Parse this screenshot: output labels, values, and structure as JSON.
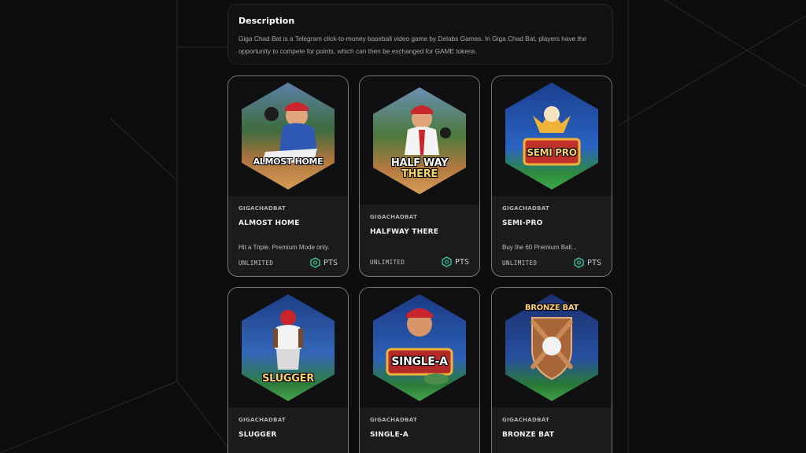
{
  "description": {
    "title": "Description",
    "text": "Giga Chad Bat is a Telegram click-to-money baseball video game by Delabs Games. In Giga Chad Bat, players have the opportunity to compete for points, which can then be exchanged for GAME tokens."
  },
  "cards": [
    {
      "org": "GIGACHADBAT",
      "title": "ALMOST HOME",
      "badge": "ALMOST HOME",
      "desc": "Hit a Triple. Premium Mode only.",
      "supply": "UNLIMITED",
      "price": "PTS",
      "icon": "player-sliding-icon"
    },
    {
      "org": "GIGACHADBAT",
      "title": "HALFWAY THERE",
      "badge_line1": "HALF WAY",
      "badge_line2": "THERE",
      "desc": "",
      "supply": "UNLIMITED",
      "price": "PTS",
      "icon": "player-running-icon"
    },
    {
      "org": "GIGACHADBAT",
      "title": "SEMI-PRO",
      "badge": "SEMI PRO",
      "desc": "Buy the 60 Premium Ball...",
      "supply": "UNLIMITED",
      "price": "PTS",
      "icon": "baseball-trophy-icon"
    },
    {
      "org": "GIGACHADBAT",
      "title": "SLUGGER",
      "badge": "SLUGGER",
      "icon": "batter-back-icon"
    },
    {
      "org": "GIGACHADBAT",
      "title": "SINGLE-A",
      "badge": "SINGLE-A",
      "icon": "player-portrait-icon"
    },
    {
      "org": "GIGACHADBAT",
      "title": "BRONZE BAT",
      "badge": "BRONZE BAT",
      "icon": "crossed-bats-icon"
    }
  ],
  "colors": {
    "background": "#0d0d0e",
    "card": "#1b1b1d",
    "card_border": "#77777c",
    "pts_icon": "#2fd3a0"
  }
}
